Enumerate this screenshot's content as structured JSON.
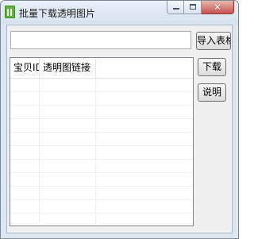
{
  "window": {
    "title": "批量下载透明图片",
    "icon": "app-icon",
    "caption": {
      "minimize": "minimize-icon",
      "maximize": "maximize-icon",
      "close_label": "✕"
    }
  },
  "toolbar": {
    "input_value": "",
    "import_label": "导入表格"
  },
  "table": {
    "columns": [
      "宝贝ID",
      "透明图链接",
      ""
    ],
    "rows": []
  },
  "side_buttons": {
    "download_label": "下载",
    "help_label": "说明"
  },
  "colors": {
    "title_bg": "#dce7f2",
    "client_bg": "#f0f0f0",
    "close_btn": "#c75050"
  }
}
